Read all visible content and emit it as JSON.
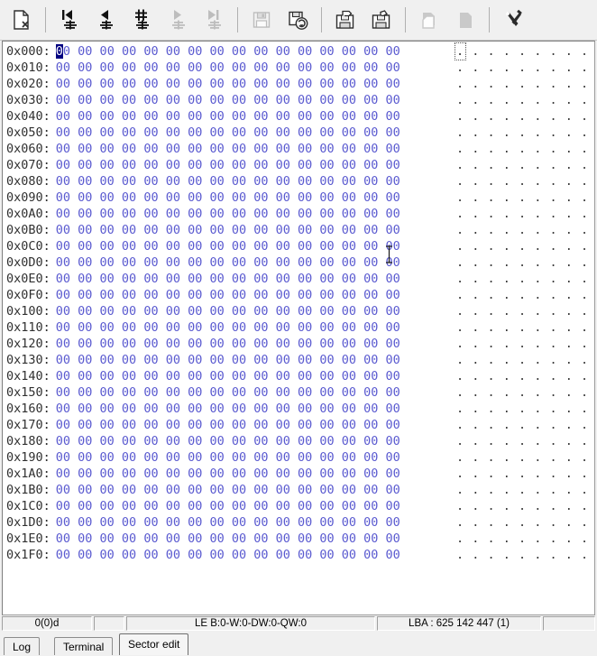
{
  "toolbar": {
    "buttons": [
      {
        "name": "new-document-icon",
        "label": "New",
        "enabled": true
      },
      {
        "name": "first-sector-icon",
        "label": "First sector",
        "enabled": true
      },
      {
        "name": "previous-sector-icon",
        "label": "Previous sector",
        "enabled": true
      },
      {
        "name": "goto-sector-icon",
        "label": "Go to sector",
        "enabled": true
      },
      {
        "name": "next-sector-icon",
        "label": "Next sector",
        "enabled": false
      },
      {
        "name": "last-sector-icon",
        "label": "Last sector",
        "enabled": false
      },
      {
        "name": "save-icon",
        "label": "Save",
        "enabled": false
      },
      {
        "name": "save-refresh-icon",
        "label": "Reload sector",
        "enabled": true
      },
      {
        "name": "load-file-icon",
        "label": "Load from file",
        "enabled": true
      },
      {
        "name": "save-file-icon",
        "label": "Save to file",
        "enabled": true
      },
      {
        "name": "copy-icon",
        "label": "Copy",
        "enabled": false
      },
      {
        "name": "paste-icon",
        "label": "Paste",
        "enabled": false
      },
      {
        "name": "tools-icon",
        "label": "Tools",
        "enabled": true
      }
    ]
  },
  "hex": {
    "bytes_per_row": 16,
    "byte_value": "00",
    "ascii_char": ".",
    "offset_prefix": "0x",
    "offset_suffix": ":",
    "cursor_nibble": "0",
    "offsets": [
      "0x000:",
      "0x010:",
      "0x020:",
      "0x030:",
      "0x040:",
      "0x050:",
      "0x060:",
      "0x070:",
      "0x080:",
      "0x090:",
      "0x0A0:",
      "0x0B0:",
      "0x0C0:",
      "0x0D0:",
      "0x0E0:",
      "0x0F0:",
      "0x100:",
      "0x110:",
      "0x120:",
      "0x130:",
      "0x140:",
      "0x150:",
      "0x160:",
      "0x170:",
      "0x180:",
      "0x190:",
      "0x1A0:",
      "0x1B0:",
      "0x1C0:",
      "0x1D0:",
      "0x1E0:",
      "0x1F0:"
    ],
    "rows": [
      {
        "offset": "0x000:",
        "bytes": [
          "00",
          "00",
          "00",
          "00",
          "00",
          "00",
          "00",
          "00",
          "00",
          "00",
          "00",
          "00",
          "00",
          "00",
          "00",
          "00"
        ],
        "ascii": "................"
      },
      {
        "offset": "0x010:",
        "bytes": [
          "00",
          "00",
          "00",
          "00",
          "00",
          "00",
          "00",
          "00",
          "00",
          "00",
          "00",
          "00",
          "00",
          "00",
          "00",
          "00"
        ],
        "ascii": "................"
      },
      {
        "offset": "0x020:",
        "bytes": [
          "00",
          "00",
          "00",
          "00",
          "00",
          "00",
          "00",
          "00",
          "00",
          "00",
          "00",
          "00",
          "00",
          "00",
          "00",
          "00"
        ],
        "ascii": "................"
      },
      {
        "offset": "0x030:",
        "bytes": [
          "00",
          "00",
          "00",
          "00",
          "00",
          "00",
          "00",
          "00",
          "00",
          "00",
          "00",
          "00",
          "00",
          "00",
          "00",
          "00"
        ],
        "ascii": "................"
      },
      {
        "offset": "0x040:",
        "bytes": [
          "00",
          "00",
          "00",
          "00",
          "00",
          "00",
          "00",
          "00",
          "00",
          "00",
          "00",
          "00",
          "00",
          "00",
          "00",
          "00"
        ],
        "ascii": "................"
      },
      {
        "offset": "0x050:",
        "bytes": [
          "00",
          "00",
          "00",
          "00",
          "00",
          "00",
          "00",
          "00",
          "00",
          "00",
          "00",
          "00",
          "00",
          "00",
          "00",
          "00"
        ],
        "ascii": "................"
      },
      {
        "offset": "0x060:",
        "bytes": [
          "00",
          "00",
          "00",
          "00",
          "00",
          "00",
          "00",
          "00",
          "00",
          "00",
          "00",
          "00",
          "00",
          "00",
          "00",
          "00"
        ],
        "ascii": "................"
      },
      {
        "offset": "0x070:",
        "bytes": [
          "00",
          "00",
          "00",
          "00",
          "00",
          "00",
          "00",
          "00",
          "00",
          "00",
          "00",
          "00",
          "00",
          "00",
          "00",
          "00"
        ],
        "ascii": "................"
      },
      {
        "offset": "0x080:",
        "bytes": [
          "00",
          "00",
          "00",
          "00",
          "00",
          "00",
          "00",
          "00",
          "00",
          "00",
          "00",
          "00",
          "00",
          "00",
          "00",
          "00"
        ],
        "ascii": "................"
      },
      {
        "offset": "0x090:",
        "bytes": [
          "00",
          "00",
          "00",
          "00",
          "00",
          "00",
          "00",
          "00",
          "00",
          "00",
          "00",
          "00",
          "00",
          "00",
          "00",
          "00"
        ],
        "ascii": "................"
      },
      {
        "offset": "0x0A0:",
        "bytes": [
          "00",
          "00",
          "00",
          "00",
          "00",
          "00",
          "00",
          "00",
          "00",
          "00",
          "00",
          "00",
          "00",
          "00",
          "00",
          "00"
        ],
        "ascii": "................"
      },
      {
        "offset": "0x0B0:",
        "bytes": [
          "00",
          "00",
          "00",
          "00",
          "00",
          "00",
          "00",
          "00",
          "00",
          "00",
          "00",
          "00",
          "00",
          "00",
          "00",
          "00"
        ],
        "ascii": "................"
      },
      {
        "offset": "0x0C0:",
        "bytes": [
          "00",
          "00",
          "00",
          "00",
          "00",
          "00",
          "00",
          "00",
          "00",
          "00",
          "00",
          "00",
          "00",
          "00",
          "00",
          "00"
        ],
        "ascii": "................"
      },
      {
        "offset": "0x0D0:",
        "bytes": [
          "00",
          "00",
          "00",
          "00",
          "00",
          "00",
          "00",
          "00",
          "00",
          "00",
          "00",
          "00",
          "00",
          "00",
          "00",
          "00"
        ],
        "ascii": "................"
      },
      {
        "offset": "0x0E0:",
        "bytes": [
          "00",
          "00",
          "00",
          "00",
          "00",
          "00",
          "00",
          "00",
          "00",
          "00",
          "00",
          "00",
          "00",
          "00",
          "00",
          "00"
        ],
        "ascii": "................"
      },
      {
        "offset": "0x0F0:",
        "bytes": [
          "00",
          "00",
          "00",
          "00",
          "00",
          "00",
          "00",
          "00",
          "00",
          "00",
          "00",
          "00",
          "00",
          "00",
          "00",
          "00"
        ],
        "ascii": "................"
      },
      {
        "offset": "0x100:",
        "bytes": [
          "00",
          "00",
          "00",
          "00",
          "00",
          "00",
          "00",
          "00",
          "00",
          "00",
          "00",
          "00",
          "00",
          "00",
          "00",
          "00"
        ],
        "ascii": "................"
      },
      {
        "offset": "0x110:",
        "bytes": [
          "00",
          "00",
          "00",
          "00",
          "00",
          "00",
          "00",
          "00",
          "00",
          "00",
          "00",
          "00",
          "00",
          "00",
          "00",
          "00"
        ],
        "ascii": "................"
      },
      {
        "offset": "0x120:",
        "bytes": [
          "00",
          "00",
          "00",
          "00",
          "00",
          "00",
          "00",
          "00",
          "00",
          "00",
          "00",
          "00",
          "00",
          "00",
          "00",
          "00"
        ],
        "ascii": "................"
      },
      {
        "offset": "0x130:",
        "bytes": [
          "00",
          "00",
          "00",
          "00",
          "00",
          "00",
          "00",
          "00",
          "00",
          "00",
          "00",
          "00",
          "00",
          "00",
          "00",
          "00"
        ],
        "ascii": "................"
      },
      {
        "offset": "0x140:",
        "bytes": [
          "00",
          "00",
          "00",
          "00",
          "00",
          "00",
          "00",
          "00",
          "00",
          "00",
          "00",
          "00",
          "00",
          "00",
          "00",
          "00"
        ],
        "ascii": "................"
      },
      {
        "offset": "0x150:",
        "bytes": [
          "00",
          "00",
          "00",
          "00",
          "00",
          "00",
          "00",
          "00",
          "00",
          "00",
          "00",
          "00",
          "00",
          "00",
          "00",
          "00"
        ],
        "ascii": "................"
      },
      {
        "offset": "0x160:",
        "bytes": [
          "00",
          "00",
          "00",
          "00",
          "00",
          "00",
          "00",
          "00",
          "00",
          "00",
          "00",
          "00",
          "00",
          "00",
          "00",
          "00"
        ],
        "ascii": "................"
      },
      {
        "offset": "0x170:",
        "bytes": [
          "00",
          "00",
          "00",
          "00",
          "00",
          "00",
          "00",
          "00",
          "00",
          "00",
          "00",
          "00",
          "00",
          "00",
          "00",
          "00"
        ],
        "ascii": "................"
      },
      {
        "offset": "0x180:",
        "bytes": [
          "00",
          "00",
          "00",
          "00",
          "00",
          "00",
          "00",
          "00",
          "00",
          "00",
          "00",
          "00",
          "00",
          "00",
          "00",
          "00"
        ],
        "ascii": "................"
      },
      {
        "offset": "0x190:",
        "bytes": [
          "00",
          "00",
          "00",
          "00",
          "00",
          "00",
          "00",
          "00",
          "00",
          "00",
          "00",
          "00",
          "00",
          "00",
          "00",
          "00"
        ],
        "ascii": "................"
      },
      {
        "offset": "0x1A0:",
        "bytes": [
          "00",
          "00",
          "00",
          "00",
          "00",
          "00",
          "00",
          "00",
          "00",
          "00",
          "00",
          "00",
          "00",
          "00",
          "00",
          "00"
        ],
        "ascii": "................"
      },
      {
        "offset": "0x1B0:",
        "bytes": [
          "00",
          "00",
          "00",
          "00",
          "00",
          "00",
          "00",
          "00",
          "00",
          "00",
          "00",
          "00",
          "00",
          "00",
          "00",
          "00"
        ],
        "ascii": "................"
      },
      {
        "offset": "0x1C0:",
        "bytes": [
          "00",
          "00",
          "00",
          "00",
          "00",
          "00",
          "00",
          "00",
          "00",
          "00",
          "00",
          "00",
          "00",
          "00",
          "00",
          "00"
        ],
        "ascii": "................"
      },
      {
        "offset": "0x1D0:",
        "bytes": [
          "00",
          "00",
          "00",
          "00",
          "00",
          "00",
          "00",
          "00",
          "00",
          "00",
          "00",
          "00",
          "00",
          "00",
          "00",
          "00"
        ],
        "ascii": "................"
      },
      {
        "offset": "0x1E0:",
        "bytes": [
          "00",
          "00",
          "00",
          "00",
          "00",
          "00",
          "00",
          "00",
          "00",
          "00",
          "00",
          "00",
          "00",
          "00",
          "00",
          "00"
        ],
        "ascii": "................"
      },
      {
        "offset": "0x1F0:",
        "bytes": [
          "00",
          "00",
          "00",
          "00",
          "00",
          "00",
          "00",
          "00",
          "00",
          "00",
          "00",
          "00",
          "00",
          "00",
          "00",
          "00"
        ],
        "ascii": "................"
      }
    ]
  },
  "statusbar": {
    "offset_decimal": "0(0)d",
    "spacer": "",
    "endian_values": "LE B:0-W:0-DW:0-QW:0",
    "lba": "LBA : 625 142 447 (1)",
    "trailing": ""
  },
  "tabs": [
    {
      "label": "Log",
      "active": false
    },
    {
      "label": "Terminal",
      "active": false
    },
    {
      "label": "Sector edit",
      "active": true
    }
  ],
  "colors": {
    "hex_byte": "#5a5ad0",
    "offset_text": "#303030",
    "cursor_bg": "#000080",
    "window_bg": "#f0f0f0",
    "content_bg": "#ffffff"
  }
}
